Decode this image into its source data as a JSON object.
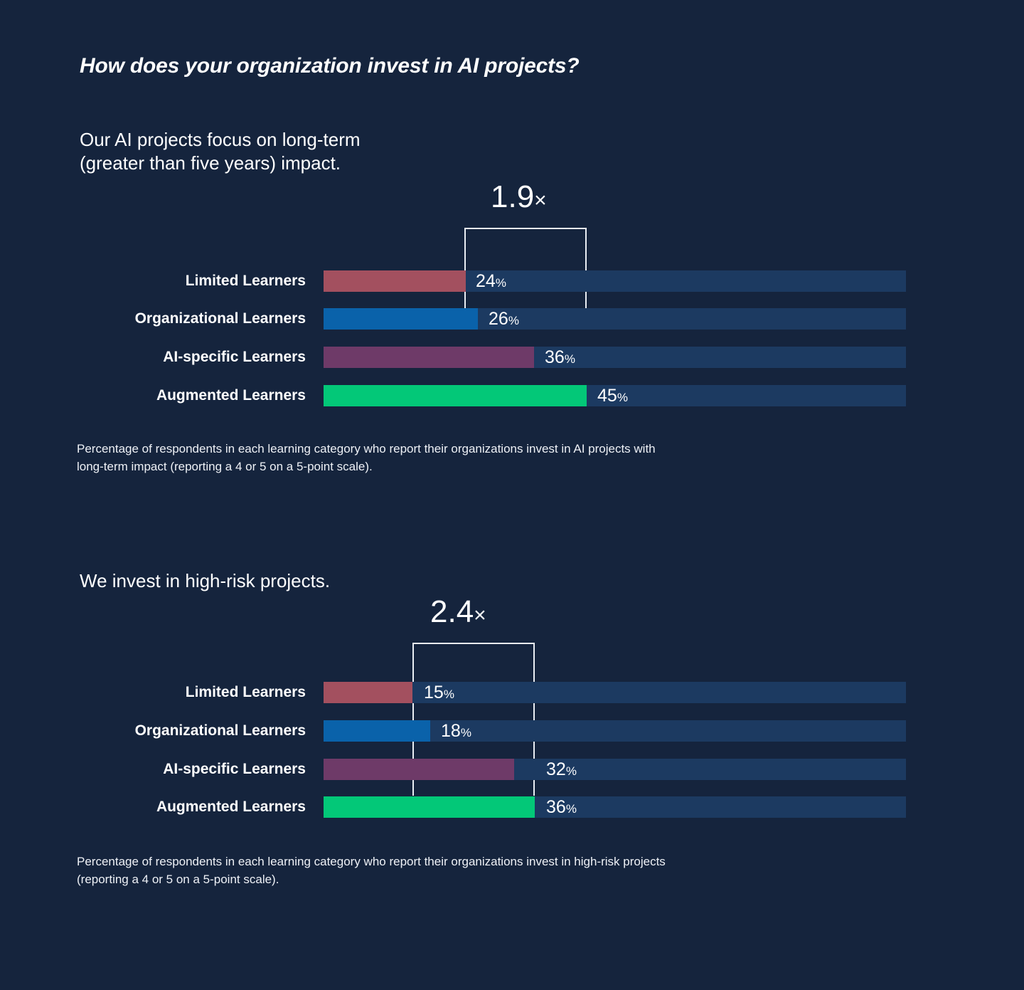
{
  "title": "How does your organization invest in AI projects?",
  "colors": {
    "background": "#15243d",
    "track": "#1c3a61",
    "text": "#ffffff",
    "bracket": "#e9edf3",
    "limited": "#a3505f",
    "organizational": "#0a62aa",
    "ai_specific": "#6e3a68",
    "augmented": "#03c878"
  },
  "charts": [
    {
      "id": "chart-1",
      "heading": "Our AI projects focus on long-term\n(greater than five years) impact.",
      "multiplier": "1.9",
      "multiplier_suffix": "×",
      "caption": "Percentage of respondents in each learning category who report their organizations invest in AI projects with\nlong-term impact  (reporting a 4 or 5 on a 5-point scale).",
      "rows": [
        {
          "label": "Limited Learners",
          "value": 24,
          "value_text": "24",
          "pct": "%",
          "color": "#a3505f"
        },
        {
          "label": "Organizational Learners",
          "value": 26,
          "value_text": "26",
          "pct": "%",
          "color": "#0a62aa"
        },
        {
          "label": "AI-specific Learners",
          "value": 36,
          "value_text": "36",
          "pct": "%",
          "color": "#6e3a68"
        },
        {
          "label": "Augmented Learners",
          "value": 45,
          "value_text": "45",
          "pct": "%",
          "color": "#03c878"
        }
      ]
    },
    {
      "id": "chart-2",
      "heading": "We invest in high-risk projects.",
      "multiplier": "2.4",
      "multiplier_suffix": "×",
      "caption": "Percentage of respondents in each learning category who report their organizations invest in high-risk projects\n(reporting a 4 or 5 on a 5-point scale).",
      "rows": [
        {
          "label": "Limited Learners",
          "value": 15,
          "value_text": "15",
          "pct": "%",
          "color": "#a3505f"
        },
        {
          "label": "Organizational Learners",
          "value": 18,
          "value_text": "18",
          "pct": "%",
          "color": "#0a62aa"
        },
        {
          "label": "AI-specific Learners",
          "value": 32,
          "value_text": "32",
          "pct": "%",
          "color": "#6e3a68"
        },
        {
          "label": "Augmented Learners",
          "value": 36,
          "value_text": "36",
          "pct": "%",
          "color": "#03c878"
        }
      ]
    }
  ],
  "chart_data": [
    {
      "type": "bar",
      "title": "Our AI projects focus on long-term (greater than five years) impact.",
      "subtitle": "How does your organization invest in AI projects?",
      "orientation": "horizontal",
      "categories": [
        "Limited Learners",
        "Organizational Learners",
        "AI-specific Learners",
        "Augmented Learners"
      ],
      "values": [
        24,
        26,
        36,
        45
      ],
      "value_labels": [
        "24%",
        "26%",
        "36%",
        "45%"
      ],
      "unit": "percent",
      "xlabel": "",
      "ylabel": "",
      "xlim": [
        0,
        100
      ],
      "grid": false,
      "legend": "none",
      "annotations": [
        {
          "text": "1.9×",
          "meaning": "Augmented Learners (45%) vs Limited Learners (24%) ratio",
          "from_category": "Limited Learners",
          "to_category": "Augmented Learners"
        }
      ],
      "note": "Percentage of respondents in each learning category who report their organizations invest in AI projects with long-term impact (reporting a 4 or 5 on a 5-point scale)."
    },
    {
      "type": "bar",
      "title": "We invest in high-risk projects.",
      "subtitle": "How does your organization invest in AI projects?",
      "orientation": "horizontal",
      "categories": [
        "Limited Learners",
        "Organizational Learners",
        "AI-specific Learners",
        "Augmented Learners"
      ],
      "values": [
        15,
        18,
        32,
        36
      ],
      "value_labels": [
        "15%",
        "18%",
        "32%",
        "36%"
      ],
      "unit": "percent",
      "xlabel": "",
      "ylabel": "",
      "xlim": [
        0,
        100
      ],
      "grid": false,
      "legend": "none",
      "annotations": [
        {
          "text": "2.4×",
          "meaning": "Augmented Learners (36%) vs Limited Learners (15%) ratio",
          "from_category": "Limited Learners",
          "to_category": "Augmented Learners"
        }
      ],
      "note": "Percentage of respondents in each learning category who report their organizations invest in high-risk projects (reporting a 4 or 5 on a 5-point scale)."
    }
  ]
}
